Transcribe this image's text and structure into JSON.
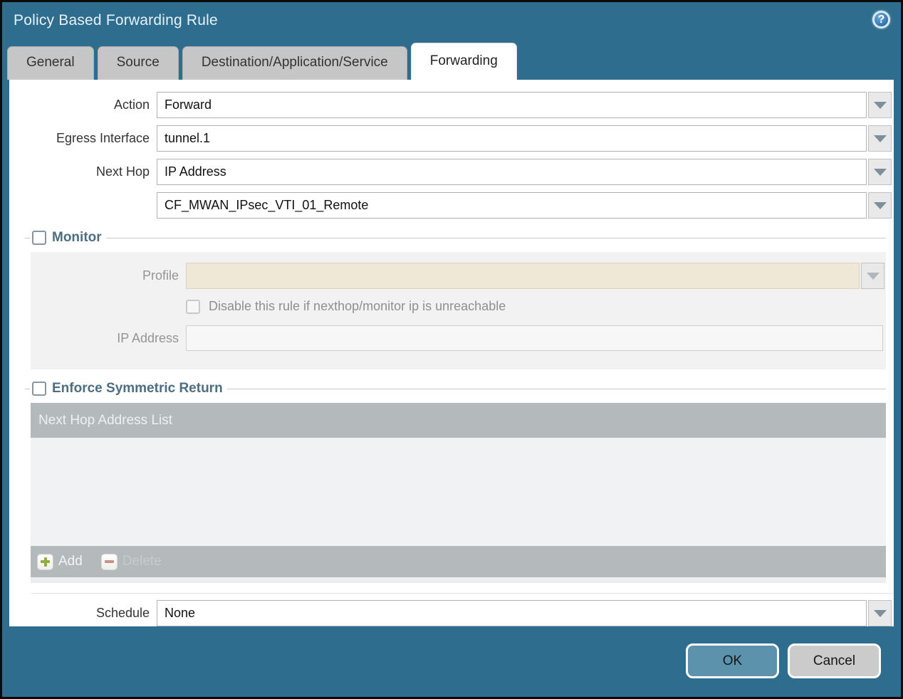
{
  "dialog": {
    "title": "Policy Based Forwarding Rule"
  },
  "tabs": [
    {
      "label": "General",
      "active": false
    },
    {
      "label": "Source",
      "active": false
    },
    {
      "label": "Destination/Application/Service",
      "active": false
    },
    {
      "label": "Forwarding",
      "active": true
    }
  ],
  "form": {
    "action": {
      "label": "Action",
      "value": "Forward"
    },
    "egress_interface": {
      "label": "Egress Interface",
      "value": "tunnel.1"
    },
    "next_hop": {
      "label": "Next Hop",
      "value": "IP Address"
    },
    "next_hop_address": {
      "value": "CF_MWAN_IPsec_VTI_01_Remote"
    },
    "schedule": {
      "label": "Schedule",
      "value": "None"
    }
  },
  "monitor": {
    "label": "Monitor",
    "checked": false,
    "profile": {
      "label": "Profile",
      "value": ""
    },
    "disable_rule": {
      "label": "Disable this rule if nexthop/monitor ip is unreachable",
      "checked": false
    },
    "ip_address": {
      "label": "IP Address",
      "value": ""
    }
  },
  "symmetric_return": {
    "label": "Enforce Symmetric Return",
    "checked": false,
    "table": {
      "header": "Next Hop Address List",
      "rows": []
    },
    "add_label": "Add",
    "delete_label": "Delete"
  },
  "footer": {
    "ok_label": "OK",
    "cancel_label": "Cancel"
  },
  "colors": {
    "titlebar_teal": "#2e6d8d",
    "tab_inactive": "#c6c6c6",
    "section_label": "#4d6d80",
    "disabled_profile_field": "#efe8d7",
    "table_bar": "#b4b9bc",
    "table_body": "#f1f2f3",
    "ok_button": "#5c92ac",
    "cancel_button": "#cbcbcb",
    "add_plus_green": "#8fae3f",
    "delete_minus_red": "#b5705e"
  }
}
